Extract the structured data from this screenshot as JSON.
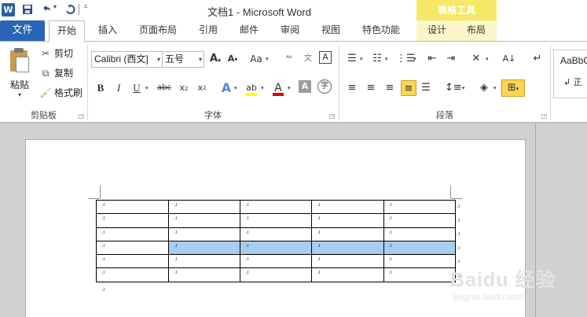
{
  "window": {
    "title": "文档1  -  Microsoft Word",
    "context_tab_header": "表格工具"
  },
  "qat": {
    "app_icon": "W",
    "save_icon": "save-icon",
    "undo_icon": "undo-icon",
    "redo_icon": "redo-icon"
  },
  "tabs": {
    "file": "文件",
    "items": [
      "开始",
      "插入",
      "页面布局",
      "引用",
      "邮件",
      "审阅",
      "视图",
      "特色功能",
      "设计",
      "布局"
    ]
  },
  "clipboard": {
    "paste": "粘贴",
    "cut": "剪切",
    "copy": "复制",
    "format_painter": "格式刷",
    "group_label": "剪贴板"
  },
  "font": {
    "name": "Calibri (西文]",
    "size": "五号",
    "group_label": "字体"
  },
  "paragraph": {
    "group_label": "段落"
  },
  "styles": {
    "sample": "AaBbC",
    "name": "↲ 正"
  },
  "document": {
    "cell_mark": ".ı",
    "rows": 6,
    "columns": 5,
    "selected_row": 4
  },
  "watermark": {
    "main": "Baidu 经验",
    "sub": "jingyan.baidu.com"
  },
  "colors": {
    "file_tab": "#2b63b8",
    "context_header": "#f5e868",
    "selection": "#a9cdf0",
    "highlight_yellow": "#ffff00",
    "font_color_red": "#e00000"
  }
}
